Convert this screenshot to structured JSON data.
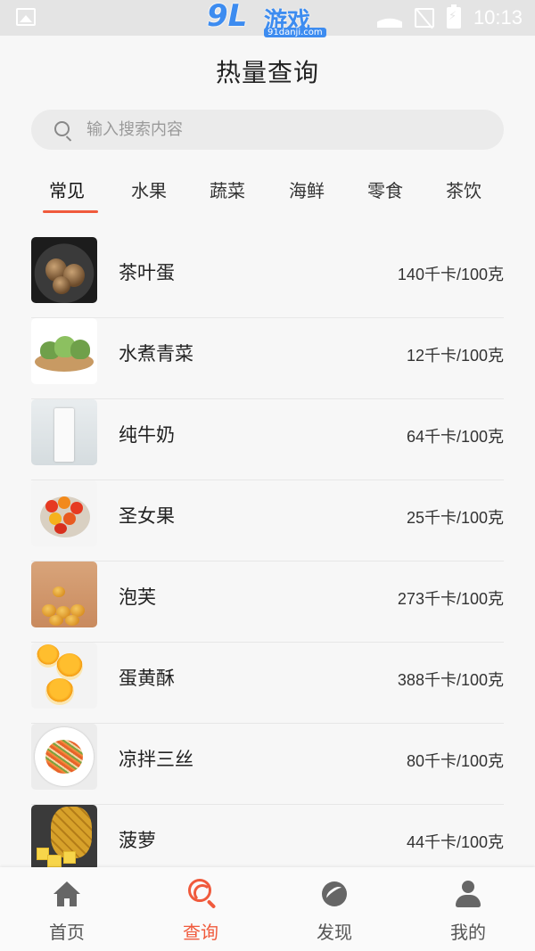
{
  "status_bar": {
    "time": "10:13",
    "watermark_logo": "9L",
    "watermark_text": "游戏",
    "watermark_domain": "91danji.com",
    "icons": [
      "image-icon",
      "wifi-icon",
      "no-sim-icon",
      "battery-charging-icon"
    ]
  },
  "header": {
    "title": "热量查询"
  },
  "search": {
    "placeholder": "输入搜索内容",
    "value": ""
  },
  "tabs": [
    {
      "label": "常见",
      "active": true
    },
    {
      "label": "水果",
      "active": false
    },
    {
      "label": "蔬菜",
      "active": false
    },
    {
      "label": "海鲜",
      "active": false
    },
    {
      "label": "零食",
      "active": false
    },
    {
      "label": "茶饮",
      "active": false
    }
  ],
  "foods": [
    {
      "name": "茶叶蛋",
      "calories": "140千卡/100克",
      "icon": "tea-egg-photo"
    },
    {
      "name": "水煮青菜",
      "calories": "12千卡/100克",
      "icon": "boiled-greens-photo"
    },
    {
      "name": "纯牛奶",
      "calories": "64千卡/100克",
      "icon": "milk-carton-photo"
    },
    {
      "name": "圣女果",
      "calories": "25千卡/100克",
      "icon": "cherry-tomatoes-photo"
    },
    {
      "name": "泡芙",
      "calories": "273千卡/100克",
      "icon": "cream-puffs-photo"
    },
    {
      "name": "蛋黄酥",
      "calories": "388千卡/100克",
      "icon": "yolk-pastry-photo"
    },
    {
      "name": "凉拌三丝",
      "calories": "80千卡/100克",
      "icon": "shredded-salad-photo"
    },
    {
      "name": "菠萝",
      "calories": "44千卡/100克",
      "icon": "pineapple-photo"
    }
  ],
  "bottom_nav": [
    {
      "label": "首页",
      "icon": "home-icon",
      "active": false
    },
    {
      "label": "查询",
      "icon": "search-query-icon",
      "active": true
    },
    {
      "label": "发现",
      "icon": "discover-icon",
      "active": false
    },
    {
      "label": "我的",
      "icon": "profile-icon",
      "active": false
    }
  ],
  "colors": {
    "accent": "#f05a3c",
    "background": "#f7f7f7",
    "status_bar": "#e4e4e4"
  }
}
